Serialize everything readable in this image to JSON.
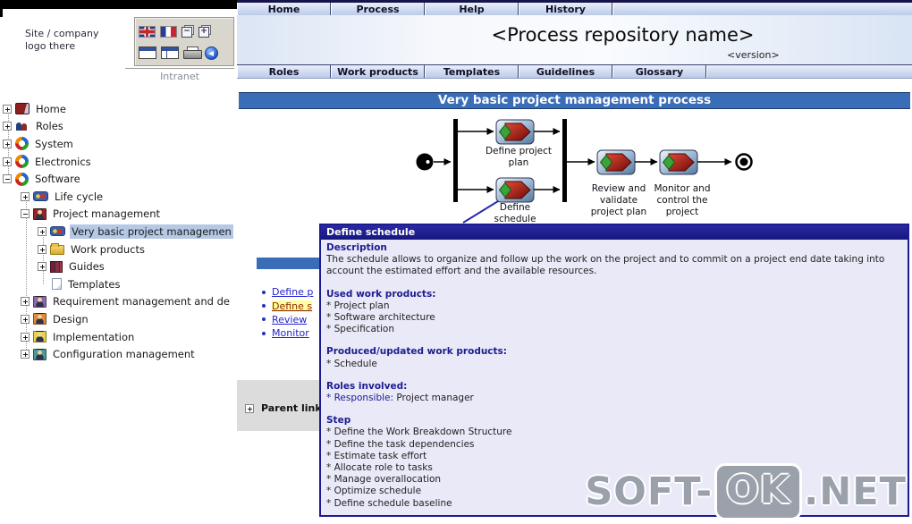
{
  "header": {
    "logo_text": "Site / company logo there",
    "intranet_label": "Intranet",
    "top_tabs": [
      "Home",
      "Process",
      "Help",
      "History"
    ],
    "title": "<Process repository name>",
    "version": "<version>",
    "second_tabs": [
      "Roles",
      "Work products",
      "Templates",
      "Guidelines",
      "Glossary"
    ]
  },
  "sidebar": {
    "tree": [
      {
        "label": "Home"
      },
      {
        "label": "Roles"
      },
      {
        "label": "System"
      },
      {
        "label": "Electronics"
      },
      {
        "label": "Software"
      },
      {
        "label": "Life cycle"
      },
      {
        "label": "Project management"
      },
      {
        "label": "Very basic project managemen"
      },
      {
        "label": "Work products"
      },
      {
        "label": "Guides"
      },
      {
        "label": "Templates"
      },
      {
        "label": "Requirement management and de"
      },
      {
        "label": "Design"
      },
      {
        "label": "Implementation"
      },
      {
        "label": "Configuration management"
      }
    ]
  },
  "main": {
    "banner": "Very basic project management process",
    "diagram": {
      "tasks": [
        "Define project plan",
        "Define schedule",
        "Review and validate project plan",
        "Monitor and control the project"
      ]
    },
    "task_links": [
      "Define p",
      "Define s",
      "Review",
      "Monitor"
    ],
    "parent_links_label": "Parent links"
  },
  "popup": {
    "title": "Define schedule",
    "description_heading": "Description",
    "description_text": "The schedule allows to organize and follow up the work on the project and to commit on a project end date taking into account the estimated effort and the available resources.",
    "used_heading": "Used work products:",
    "used_items": [
      "* Project plan",
      "* Software architecture",
      "* Specification"
    ],
    "produced_heading": "Produced/updated work products:",
    "produced_items": [
      "* Schedule"
    ],
    "roles_heading": "Roles involved:",
    "roles_items": [
      {
        "prefix": "* Responsible:",
        "value": " Project manager"
      }
    ],
    "step_heading": "Step",
    "step_items": [
      "* Define the Work Breakdown Structure",
      "* Define the task dependencies",
      "* Estimate task effort",
      "* Allocate role to tasks",
      "* Manage overallocation",
      "* Optimize schedule",
      "* Define schedule baseline"
    ]
  },
  "watermark": {
    "prefix": "SOFT-",
    "badge": "OK",
    "suffix": ".NET"
  },
  "colors": {
    "banner": "#3a6db8",
    "popup_title_bg": "#1c1c90",
    "popup_body_bg": "#e9e9f8",
    "accent_navy": "#1c1c90",
    "link_blue": "#2222cc",
    "active_link_bg": "#ffffa0"
  }
}
